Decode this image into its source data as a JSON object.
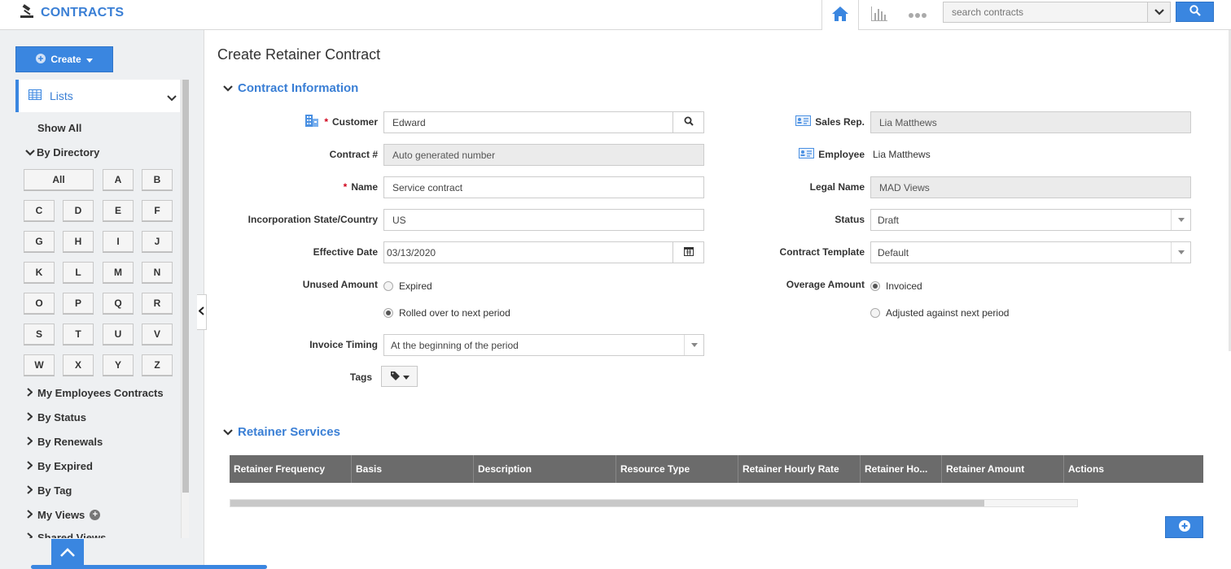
{
  "app": {
    "title": "CONTRACTS"
  },
  "search": {
    "placeholder": "search contracts"
  },
  "sidebar": {
    "create_label": "Create",
    "lists_label": "Lists",
    "show_all": "Show All",
    "by_directory": "By Directory",
    "letters": [
      "All",
      "A",
      "B",
      "C",
      "D",
      "E",
      "F",
      "G",
      "H",
      "I",
      "J",
      "K",
      "L",
      "M",
      "N",
      "O",
      "P",
      "Q",
      "R",
      "S",
      "T",
      "U",
      "V",
      "W",
      "X",
      "Y",
      "Z"
    ],
    "groups": [
      "My Employees Contracts",
      "By Status",
      "By Renewals",
      "By Expired",
      "By Tag",
      "My Views",
      "Shared Views"
    ]
  },
  "page": {
    "title": "Create Retainer Contract"
  },
  "contract_info": {
    "heading": "Contract Information",
    "customer": {
      "label": "Customer",
      "value": "Edward"
    },
    "contract_no": {
      "label": "Contract #",
      "value": "Auto generated number"
    },
    "name": {
      "label": "Name",
      "value": "Service contract"
    },
    "incorporation": {
      "label": "Incorporation State/Country",
      "value": "US"
    },
    "effective_date": {
      "label": "Effective Date",
      "value": "03/13/2020"
    },
    "unused_amount": {
      "label": "Unused Amount",
      "options": [
        "Expired",
        "Rolled over to next period"
      ],
      "selected": "Rolled over to next period"
    },
    "invoice_timing": {
      "label": "Invoice Timing",
      "value": "At the beginning of the period"
    },
    "tags": {
      "label": "Tags"
    },
    "sales_rep": {
      "label": "Sales Rep.",
      "value": "Lia Matthews"
    },
    "employee": {
      "label": "Employee",
      "value": "Lia Matthews"
    },
    "legal_name": {
      "label": "Legal Name",
      "value": "MAD Views"
    },
    "status": {
      "label": "Status",
      "value": "Draft"
    },
    "contract_template": {
      "label": "Contract Template",
      "value": "Default"
    },
    "overage_amount": {
      "label": "Overage Amount",
      "options": [
        "Invoiced",
        "Adjusted against next period"
      ],
      "selected": "Invoiced"
    }
  },
  "retainer_services": {
    "heading": "Retainer Services",
    "columns": [
      "Retainer Frequency",
      "Basis",
      "Description",
      "Resource Type",
      "Retainer Hourly Rate",
      "Retainer Ho...",
      "Retainer Amount",
      "Actions"
    ]
  },
  "colors": {
    "accent": "#3a86e0",
    "grid_header": "#6b6b6b",
    "required": "#d0021b"
  }
}
